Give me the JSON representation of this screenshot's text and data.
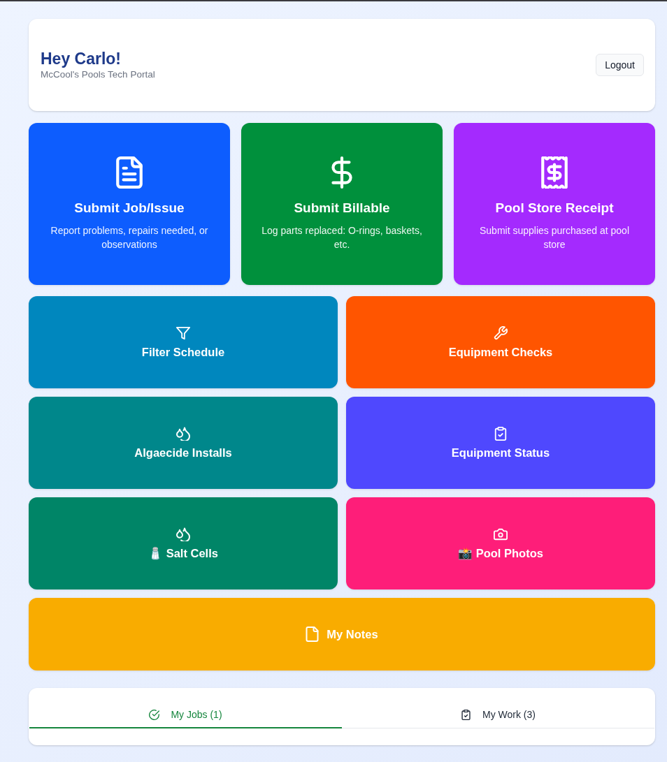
{
  "header": {
    "title": "Hey Carlo!",
    "subtitle": "McCool's Pools Tech Portal",
    "logout_button": "Logout"
  },
  "primary_actions": [
    {
      "title": "Submit Job/Issue",
      "description": "Report problems, repairs needed, or observations",
      "color": "#0d5dfe"
    },
    {
      "title": "Submit Billable",
      "description": "Log parts replaced: O-rings, baskets, etc.",
      "color": "#00903c"
    },
    {
      "title": "Pool Store Receipt",
      "description": "Submit supplies purchased at pool store",
      "color": "#a42afe"
    }
  ],
  "secondary_actions": [
    {
      "label": "Filter Schedule",
      "color": "#0087be"
    },
    {
      "label": "Equipment Checks",
      "color": "#ff5500"
    },
    {
      "label": "Algaecide Installs",
      "color": "#00878b"
    },
    {
      "label": "Equipment Status",
      "color": "#4f48fe"
    },
    {
      "label": "🧂 Salt Cells",
      "color": "#008567"
    },
    {
      "label": "📸 Pool Photos",
      "color": "#fe1e79"
    }
  ],
  "notes_button": {
    "label": "My Notes",
    "color": "#f9ac00"
  },
  "tabs": [
    {
      "label": "My Jobs (1)",
      "selected": true
    },
    {
      "label": "My Work (3)",
      "selected": false
    }
  ]
}
